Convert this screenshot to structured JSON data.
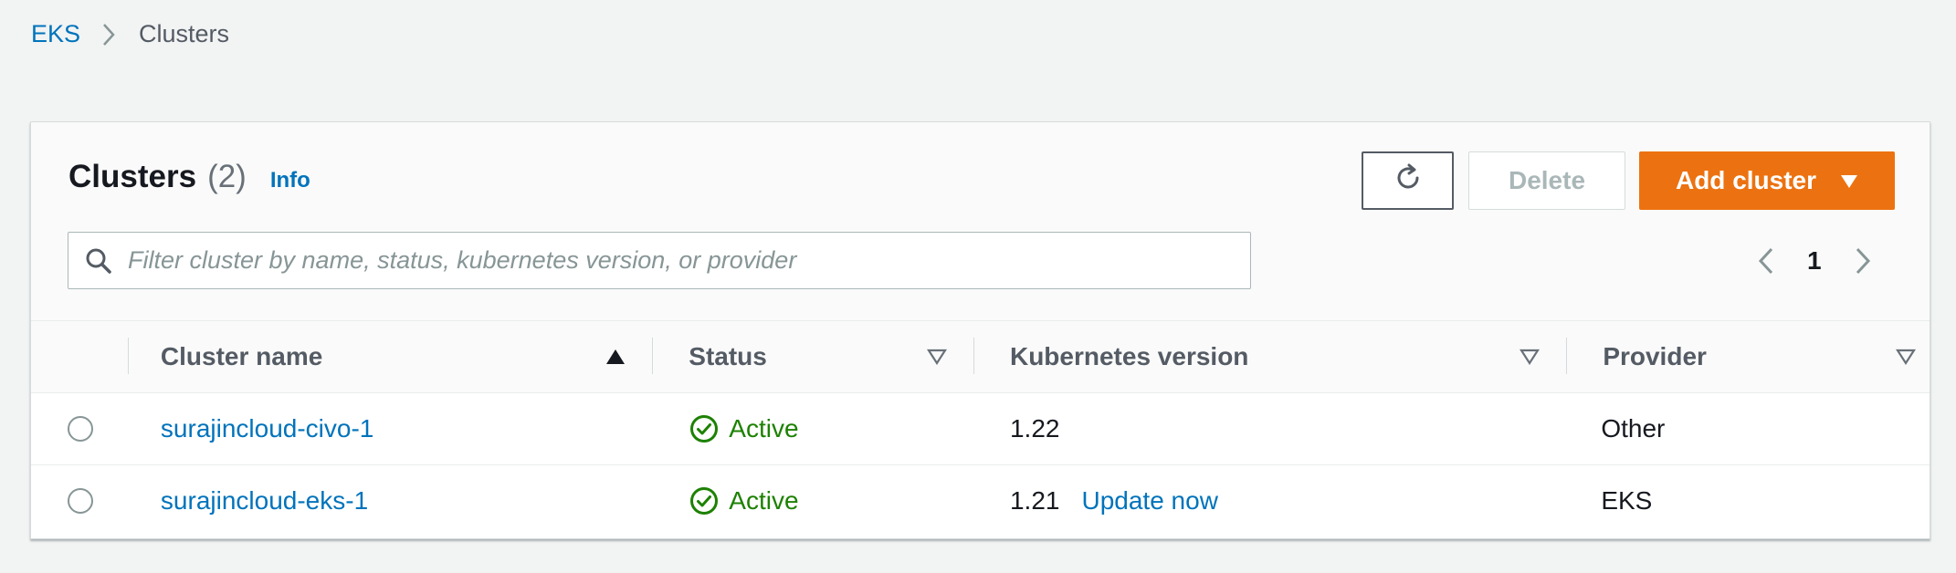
{
  "breadcrumb": {
    "root": "EKS",
    "current": "Clusters"
  },
  "panel": {
    "title": "Clusters",
    "count": "(2)",
    "info": "Info"
  },
  "actions": {
    "refresh_icon": "refresh-icon",
    "delete_label": "Delete",
    "add_label": "Add cluster",
    "add_caret": "caret-down-icon"
  },
  "search": {
    "placeholder": "Filter cluster by name, status, kubernetes version, or provider",
    "value": ""
  },
  "pagination": {
    "page": "1"
  },
  "table": {
    "headers": {
      "name": "Cluster name",
      "status": "Status",
      "version": "Kubernetes version",
      "provider": "Provider"
    },
    "rows": [
      {
        "name": "surajincloud-civo-1",
        "status": "Active",
        "version": "1.22",
        "update": "",
        "provider": "Other"
      },
      {
        "name": "surajincloud-eks-1",
        "status": "Active",
        "version": "1.21",
        "update": "Update now",
        "provider": "EKS"
      }
    ]
  },
  "colors": {
    "link": "#0073bb",
    "primary": "#ec7211",
    "success": "#1d8102",
    "background": "#f2f3f3"
  }
}
